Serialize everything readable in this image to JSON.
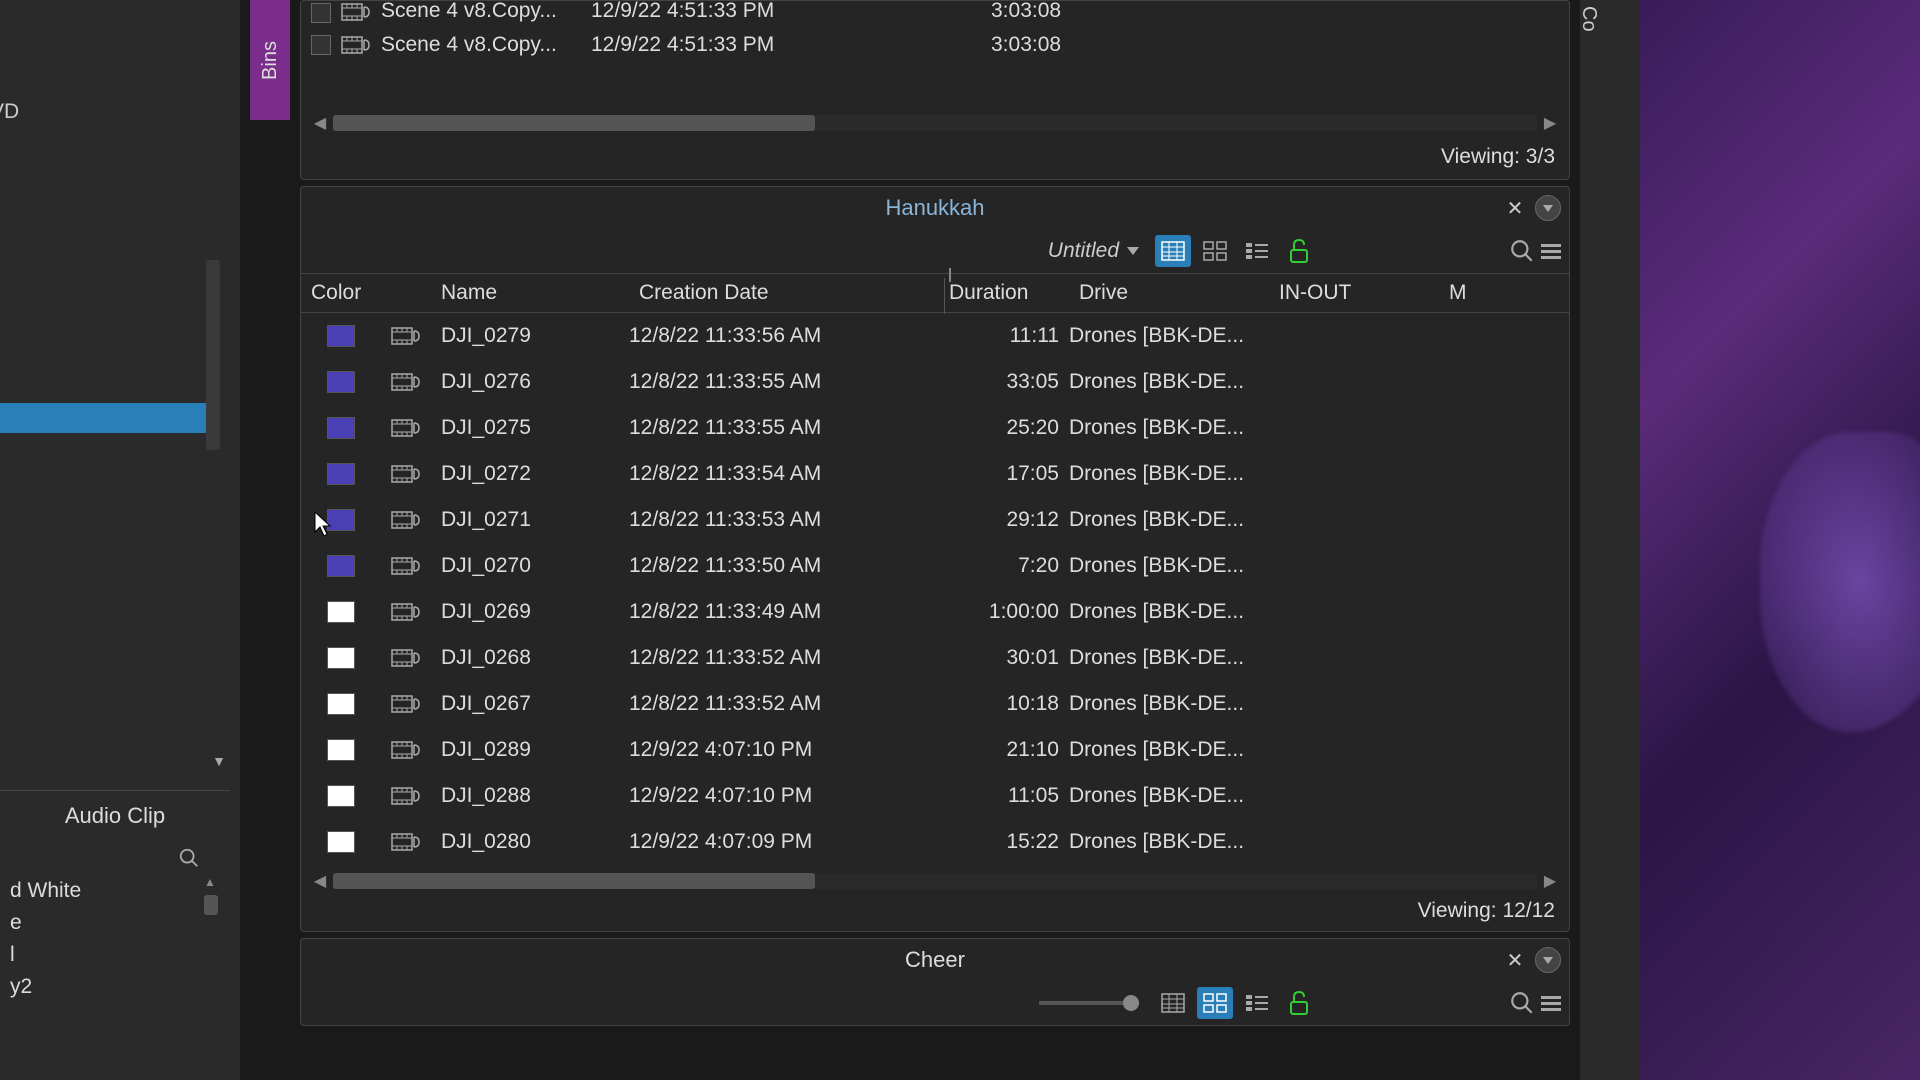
{
  "left_sidebar": {
    "top_text": "VD",
    "audio_panel_title": "Audio Clip",
    "list_items": [
      "d White",
      "e",
      "l",
      "y2"
    ]
  },
  "bins_tab": "Bins",
  "right_tab": "Co",
  "top_bin": {
    "rows": [
      {
        "name": "Scene 4 v8.Copy...",
        "date": "12/9/22 4:51:33 PM",
        "duration": "3:03:08",
        "cutoff": true
      },
      {
        "name": "Scene 4 v8.Copy...",
        "date": "12/9/22 4:51:33 PM",
        "duration": "3:03:08"
      }
    ],
    "viewing": "Viewing: 3/3"
  },
  "mid_bin": {
    "title": "Hanukkah",
    "dropdown": "Untitled",
    "columns": {
      "color": "Color",
      "name": "Name",
      "date": "Creation Date",
      "duration": "Duration",
      "drive": "Drive",
      "inout": "IN-OUT",
      "m": "M"
    },
    "rows": [
      {
        "color": "#4a3fb5",
        "name": "DJI_0279",
        "date": "12/8/22 11:33:56 AM",
        "duration": "11:11",
        "drive": "Drones [BBK-DE..."
      },
      {
        "color": "#4a3fb5",
        "name": "DJI_0276",
        "date": "12/8/22 11:33:55 AM",
        "duration": "33:05",
        "drive": "Drones [BBK-DE..."
      },
      {
        "color": "#4a3fb5",
        "name": "DJI_0275",
        "date": "12/8/22 11:33:55 AM",
        "duration": "25:20",
        "drive": "Drones [BBK-DE..."
      },
      {
        "color": "#4a3fb5",
        "name": "DJI_0272",
        "date": "12/8/22 11:33:54 AM",
        "duration": "17:05",
        "drive": "Drones [BBK-DE..."
      },
      {
        "color": "#4a3fb5",
        "name": "DJI_0271",
        "date": "12/8/22 11:33:53 AM",
        "duration": "29:12",
        "drive": "Drones [BBK-DE..."
      },
      {
        "color": "#4a3fb5",
        "name": "DJI_0270",
        "date": "12/8/22 11:33:50 AM",
        "duration": "7:20",
        "drive": "Drones [BBK-DE..."
      },
      {
        "color": "#ffffff",
        "name": "DJI_0269",
        "date": "12/8/22 11:33:49 AM",
        "duration": "1:00:00",
        "drive": "Drones [BBK-DE..."
      },
      {
        "color": "#ffffff",
        "name": "DJI_0268",
        "date": "12/8/22 11:33:52 AM",
        "duration": "30:01",
        "drive": "Drones [BBK-DE..."
      },
      {
        "color": "#ffffff",
        "name": "DJI_0267",
        "date": "12/8/22 11:33:52 AM",
        "duration": "10:18",
        "drive": "Drones [BBK-DE..."
      },
      {
        "color": "#ffffff",
        "name": "DJI_0289",
        "date": "12/9/22 4:07:10 PM",
        "duration": "21:10",
        "drive": "Drones [BBK-DE..."
      },
      {
        "color": "#ffffff",
        "name": "DJI_0288",
        "date": "12/9/22 4:07:10 PM",
        "duration": "11:05",
        "drive": "Drones [BBK-DE..."
      },
      {
        "color": "#ffffff",
        "name": "DJI_0280",
        "date": "12/9/22 4:07:09 PM",
        "duration": "15:22",
        "drive": "Drones [BBK-DE..."
      }
    ],
    "viewing": "Viewing: 12/12"
  },
  "bottom_bin": {
    "title": "Cheer"
  }
}
